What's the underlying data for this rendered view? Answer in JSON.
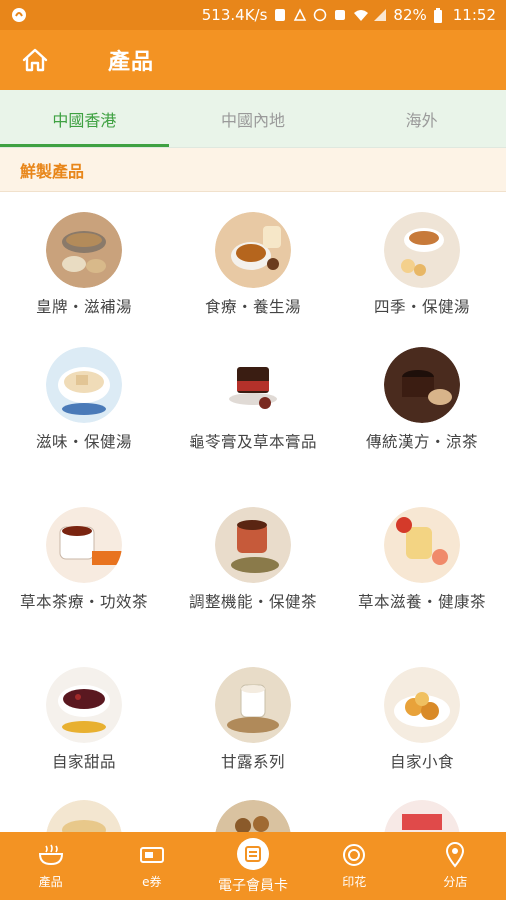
{
  "status_bar": {
    "network_speed": "513.4K/s",
    "battery": "82%",
    "time": "11:52"
  },
  "app_bar": {
    "title": "產品",
    "home_icon": "home-icon"
  },
  "tabs": [
    {
      "label": "中國香港",
      "active": true
    },
    {
      "label": "中國內地",
      "active": false
    },
    {
      "label": "海外",
      "active": false
    }
  ],
  "section": {
    "title": "鮮製產品"
  },
  "products": [
    {
      "label": "皇牌・滋補湯"
    },
    {
      "label": "食療・養生湯"
    },
    {
      "label": "四季・保健湯"
    },
    {
      "label": "滋味・保健湯"
    },
    {
      "label": "龜苓膏及草本膏品"
    },
    {
      "label": "傳統漢方・涼茶"
    },
    {
      "label": "草本茶療・功效茶"
    },
    {
      "label": "調整機能・保健茶"
    },
    {
      "label": "草本滋養・健康茶"
    },
    {
      "label": "自家甜品"
    },
    {
      "label": "甘露系列"
    },
    {
      "label": "自家小食"
    },
    {
      "label": ""
    },
    {
      "label": ""
    },
    {
      "label": ""
    }
  ],
  "bottom_nav": [
    {
      "label": "產品",
      "icon": "bowl-icon"
    },
    {
      "label": "e券",
      "icon": "ticket-icon"
    },
    {
      "label": "電子會員卡",
      "icon": "member-card-icon"
    },
    {
      "label": "印花",
      "icon": "stamp-icon"
    },
    {
      "label": "分店",
      "icon": "location-pin-icon"
    }
  ],
  "colors": {
    "primary": "#f39323",
    "accent_green": "#3fa142",
    "section_text": "#e8861a"
  }
}
